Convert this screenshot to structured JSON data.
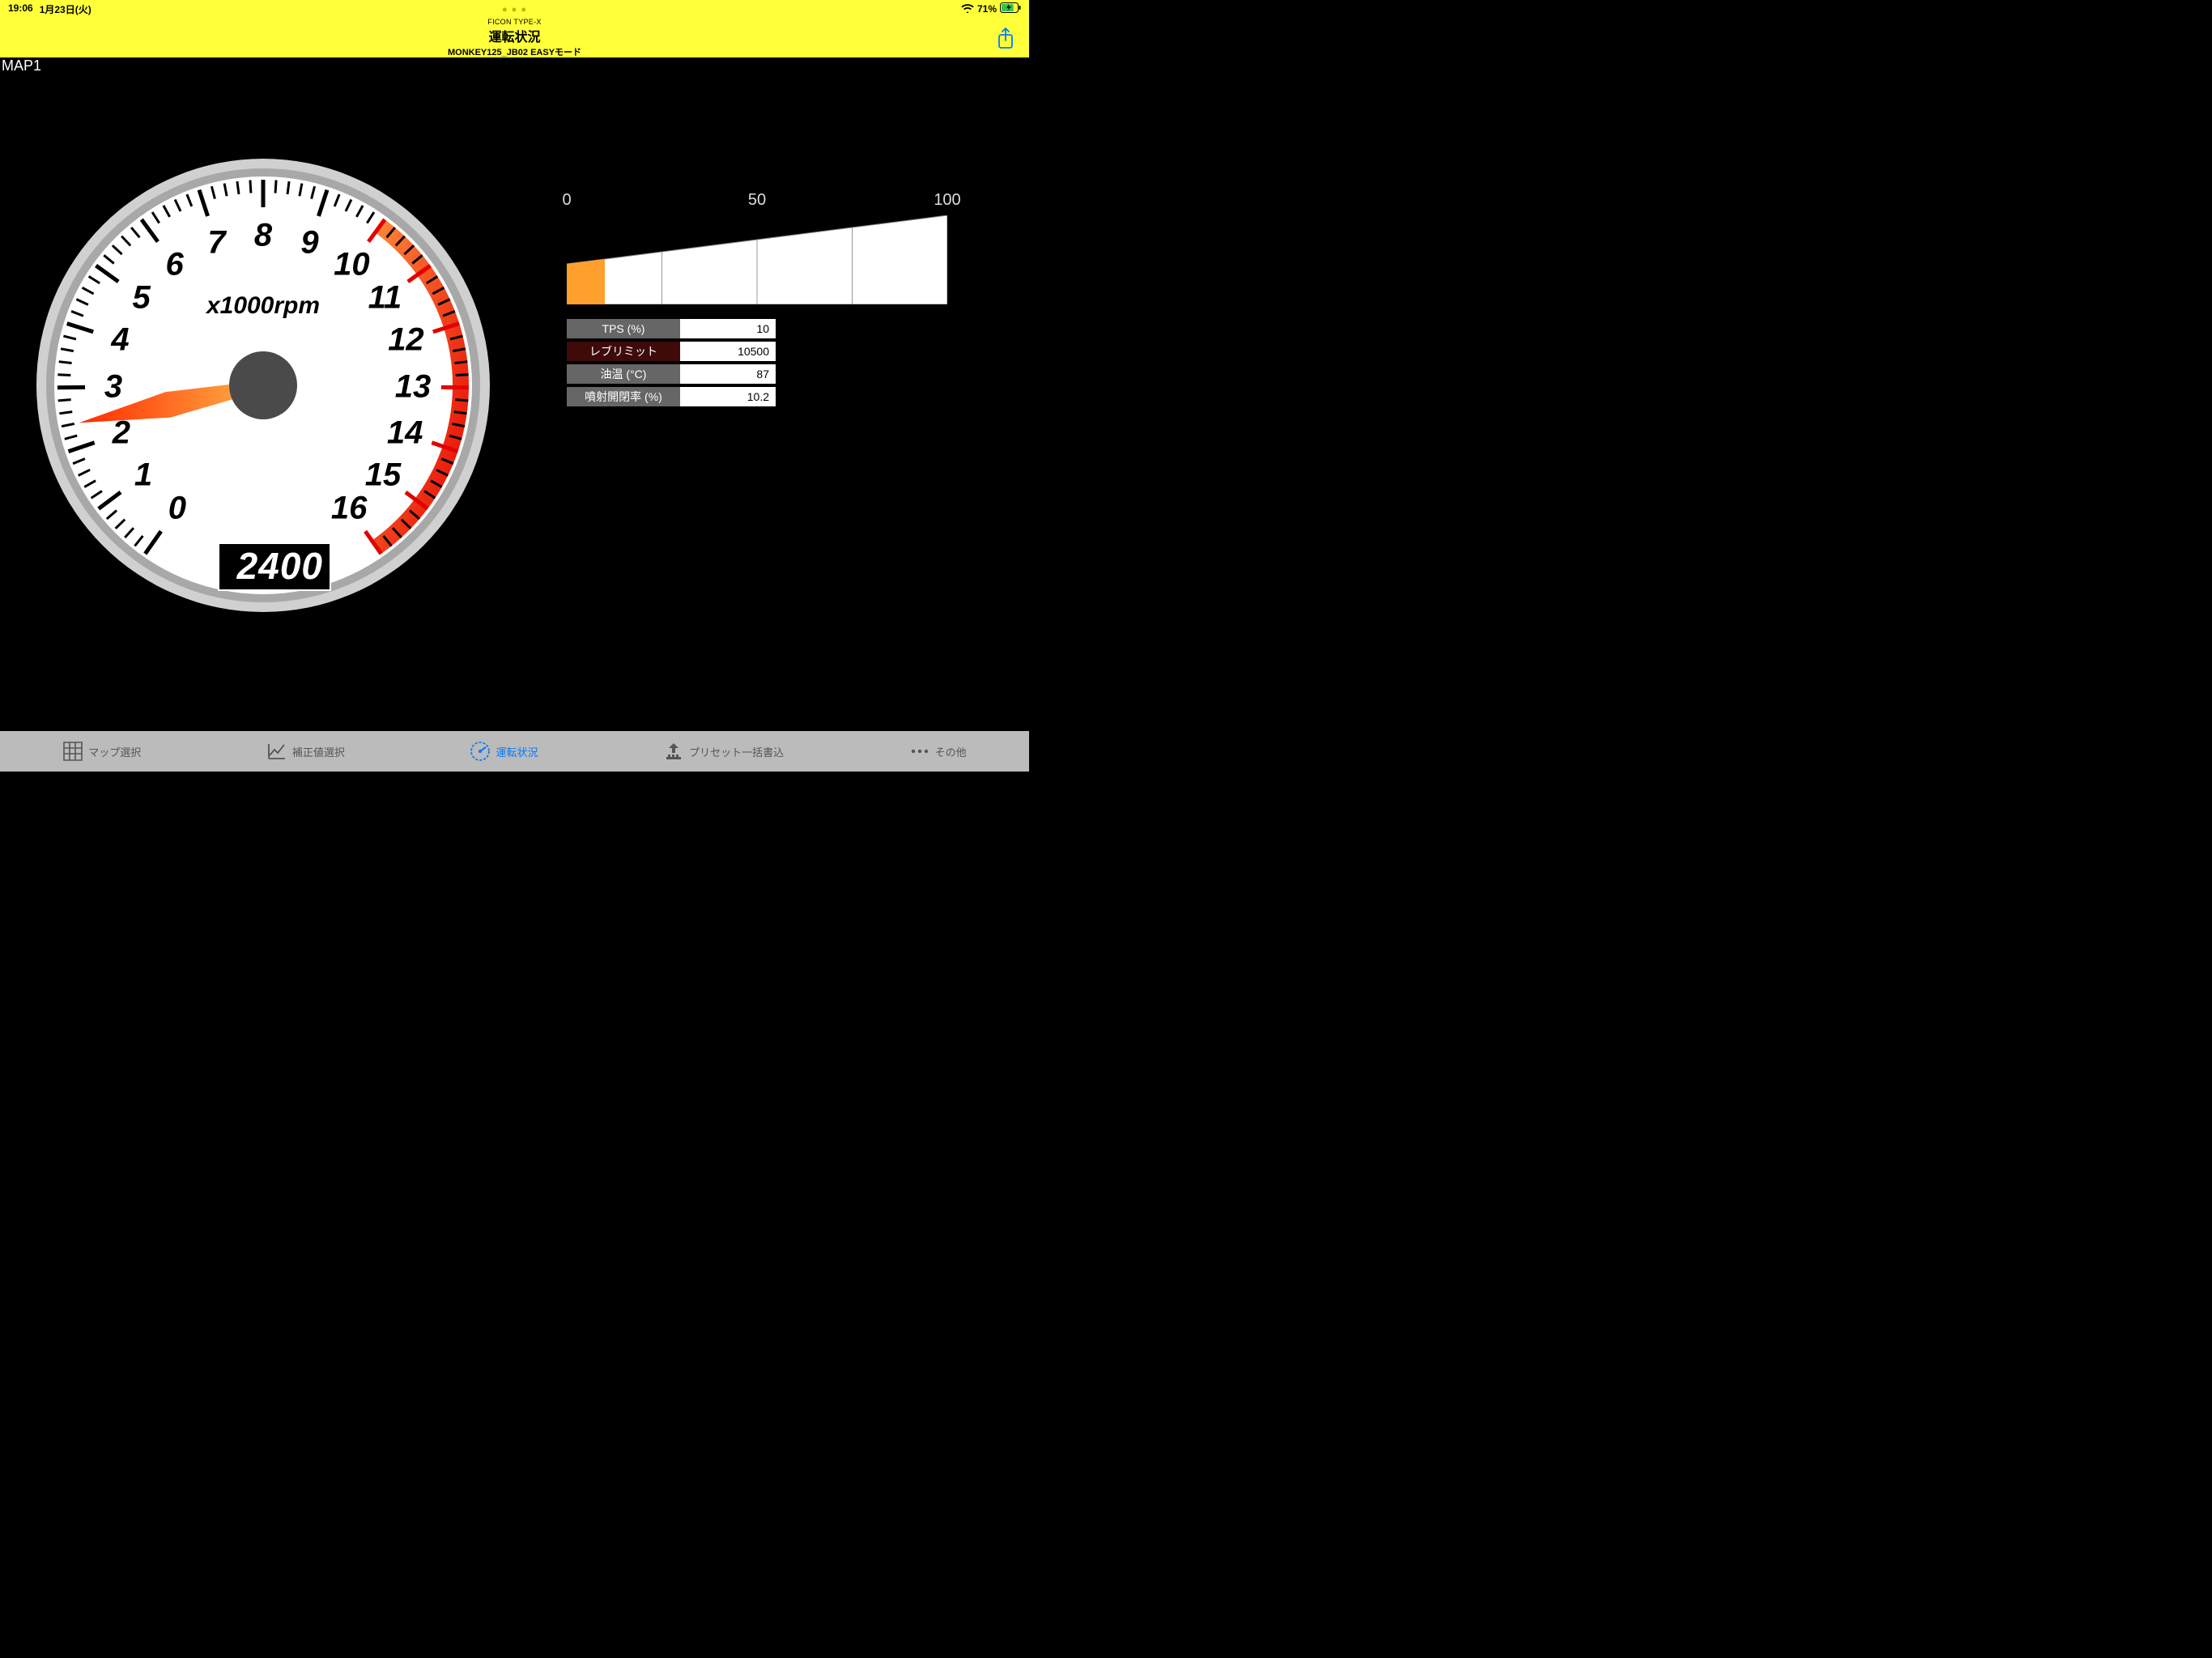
{
  "status": {
    "time": "19:06",
    "date": "1月23日(火)",
    "battery": "71%"
  },
  "header": {
    "brand": "FICON TYPE-X",
    "title": "運転状況",
    "subtitle": "MONKEY125_JB02 EASYモード"
  },
  "map_label": "MAP1",
  "gauge": {
    "unit": "x1000rpm",
    "rpm_value": "2400",
    "max": 16,
    "redline_start": 10,
    "numbers": [
      "0",
      "1",
      "2",
      "3",
      "4",
      "5",
      "6",
      "7",
      "8",
      "9",
      "10",
      "11",
      "12",
      "13",
      "14",
      "15",
      "16"
    ]
  },
  "funnel": {
    "ticks": [
      "0",
      "50",
      "100"
    ],
    "fill_percent": 10
  },
  "readouts": [
    {
      "label": "TPS (%)",
      "value": "10",
      "limit": false
    },
    {
      "label": "レブリミット",
      "value": "10500",
      "limit": true
    },
    {
      "label": "油温 (°C)",
      "value": "87",
      "limit": false
    },
    {
      "label": "噴射開閉率 (%)",
      "value": "10.2",
      "limit": false
    }
  ],
  "tabs": [
    {
      "label": "マップ選択",
      "icon": "grid-icon",
      "active": false
    },
    {
      "label": "補正値選択",
      "icon": "chart-icon",
      "active": false
    },
    {
      "label": "運転状況",
      "icon": "gauge-icon",
      "active": true
    },
    {
      "label": "プリセット一括書込",
      "icon": "upload-icon",
      "active": false
    },
    {
      "label": "その他",
      "icon": "dots-icon",
      "active": false
    }
  ],
  "chart_data": {
    "type": "gauge",
    "title": "Tachometer",
    "unit": "rpm (x1000)",
    "value": 2.4,
    "range": [
      0,
      16
    ],
    "redline": 10,
    "digital_readout": 2400,
    "tps_bar": {
      "value": 10,
      "range": [
        0,
        100
      ]
    }
  }
}
